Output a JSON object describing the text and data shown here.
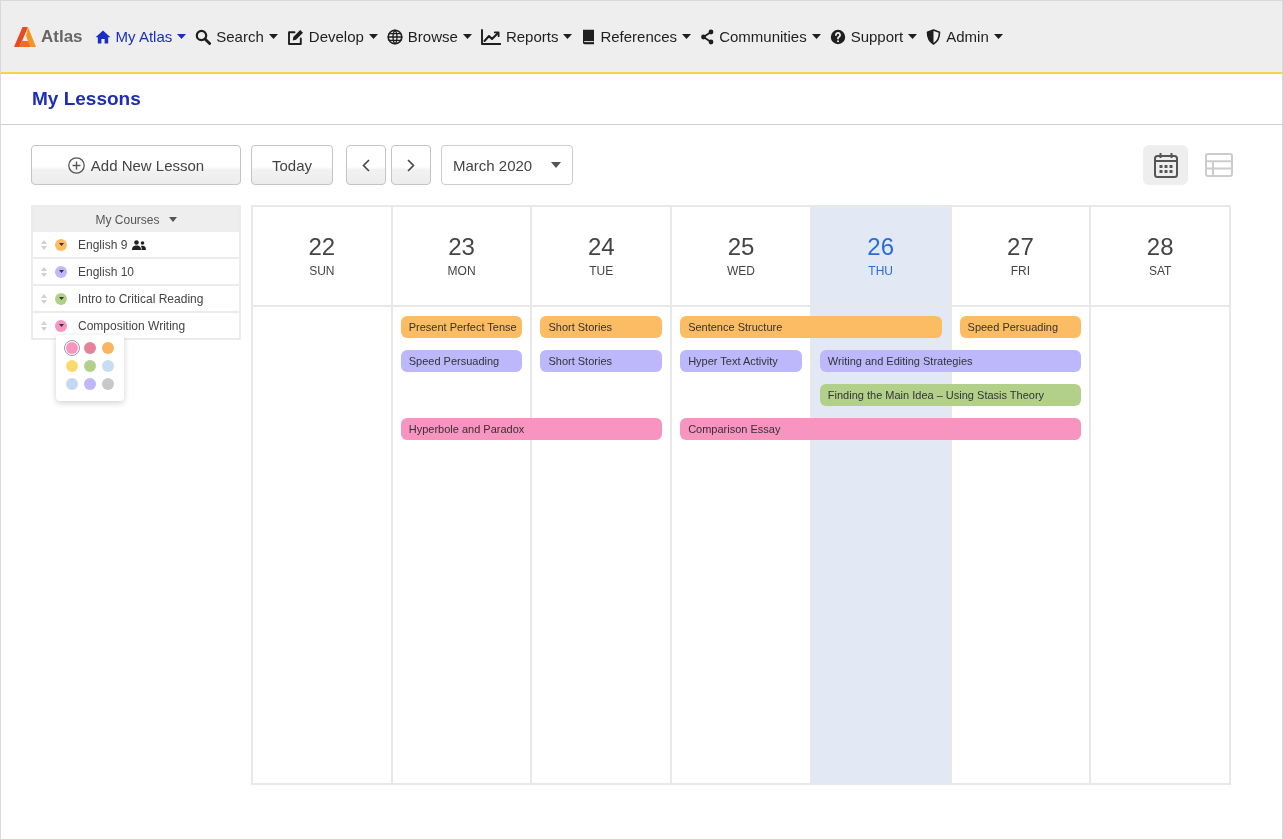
{
  "nav": {
    "logo": "Atlas",
    "items": [
      {
        "label": "My Atlas",
        "selected": true
      },
      {
        "label": "Search",
        "selected": false
      },
      {
        "label": "Develop",
        "selected": false
      },
      {
        "label": "Browse",
        "selected": false
      },
      {
        "label": "Reports",
        "selected": false
      },
      {
        "label": "References",
        "selected": false
      },
      {
        "label": "Communities",
        "selected": false
      },
      {
        "label": "Support",
        "selected": false
      },
      {
        "label": "Admin",
        "selected": false
      }
    ]
  },
  "header": {
    "title": "My Lessons"
  },
  "toolbar": {
    "add_button": "Add New Lesson",
    "today_button": "Today",
    "month": "March 2020",
    "views": [
      {
        "selected": true
      },
      {
        "selected": false
      }
    ]
  },
  "sidebar": {
    "header": "My Courses",
    "courses": [
      {
        "name": "English 9",
        "color": "#fbbc63",
        "shared": true,
        "menu_open": false
      },
      {
        "name": "English 10",
        "color": "#bdb8fb",
        "shared": false,
        "menu_open": false
      },
      {
        "name": "Intro to Critical Reading",
        "color": "#b3d08a",
        "shared": false,
        "menu_open": false
      },
      {
        "name": "Composition Writing",
        "color": "#f794c0",
        "shared": false,
        "menu_open": true
      }
    ],
    "color_picker": {
      "swatches": [
        {
          "color": "#f794c0",
          "selected": true
        },
        {
          "color": "#e8819a",
          "selected": false
        },
        {
          "color": "#fbb560",
          "selected": false
        },
        {
          "color": "#fbd96a",
          "selected": false
        },
        {
          "color": "#b3d08a",
          "selected": false
        },
        {
          "color": "#c6ddf2",
          "selected": false
        },
        {
          "color": "#c3d8f0",
          "selected": false
        },
        {
          "color": "#bdb8fb",
          "selected": false
        },
        {
          "color": "#c8c8c8",
          "selected": false
        }
      ]
    }
  },
  "calendar": {
    "days": [
      {
        "number": "22",
        "weekday": "SUN",
        "today": false
      },
      {
        "number": "23",
        "weekday": "MON",
        "today": false
      },
      {
        "number": "24",
        "weekday": "TUE",
        "today": false
      },
      {
        "number": "25",
        "weekday": "WED",
        "today": false
      },
      {
        "number": "26",
        "weekday": "THU",
        "today": true
      },
      {
        "number": "27",
        "weekday": "FRI",
        "today": false
      },
      {
        "number": "28",
        "weekday": "SAT",
        "today": false
      }
    ],
    "event_rows": [
      {
        "cells": [
          {
            "kind": "free"
          },
          {
            "kind": "event",
            "title": "Present Perfect Tense",
            "color": "#fbbc63"
          },
          {
            "kind": "event",
            "title": "Short Stories",
            "color": "#fbbc63"
          },
          {
            "kind": "event",
            "title": "Sentence Structure",
            "color": "#fbbc63"
          },
          {
            "kind": "continued"
          },
          {
            "kind": "event",
            "title": "Speed Persuading",
            "color": "#fbbc63"
          },
          {
            "kind": "free"
          }
        ]
      },
      {
        "cells": [
          {
            "kind": "free"
          },
          {
            "kind": "event",
            "title": "Speed Persuading",
            "color": "#bdb8fb"
          },
          {
            "kind": "event",
            "title": "Short Stories",
            "color": "#bdb8fb"
          },
          {
            "kind": "event",
            "title": "Hyper Text Activity",
            "color": "#bdb8fb"
          },
          {
            "kind": "event",
            "title": "Writing and Editing Strategies",
            "color": "#bdb8fb"
          },
          {
            "kind": "continued"
          },
          {
            "kind": "free"
          }
        ]
      },
      {
        "cells": [
          {
            "kind": "free"
          },
          {
            "kind": "free"
          },
          {
            "kind": "free"
          },
          {
            "kind": "free"
          },
          {
            "kind": "event",
            "title": "Finding the Main Idea – Using Stasis Theory",
            "color": "#b3d08a"
          },
          {
            "kind": "continued"
          },
          {
            "kind": "free"
          }
        ]
      },
      {
        "cells": [
          {
            "kind": "free"
          },
          {
            "kind": "event",
            "title": "Hyperbole and Paradox",
            "color": "#f794c0"
          },
          {
            "kind": "continued"
          },
          {
            "kind": "event",
            "title": "Comparison Essay",
            "color": "#f794c0"
          },
          {
            "kind": "continued"
          },
          {
            "kind": "continued"
          },
          {
            "kind": "free"
          }
        ]
      }
    ]
  }
}
